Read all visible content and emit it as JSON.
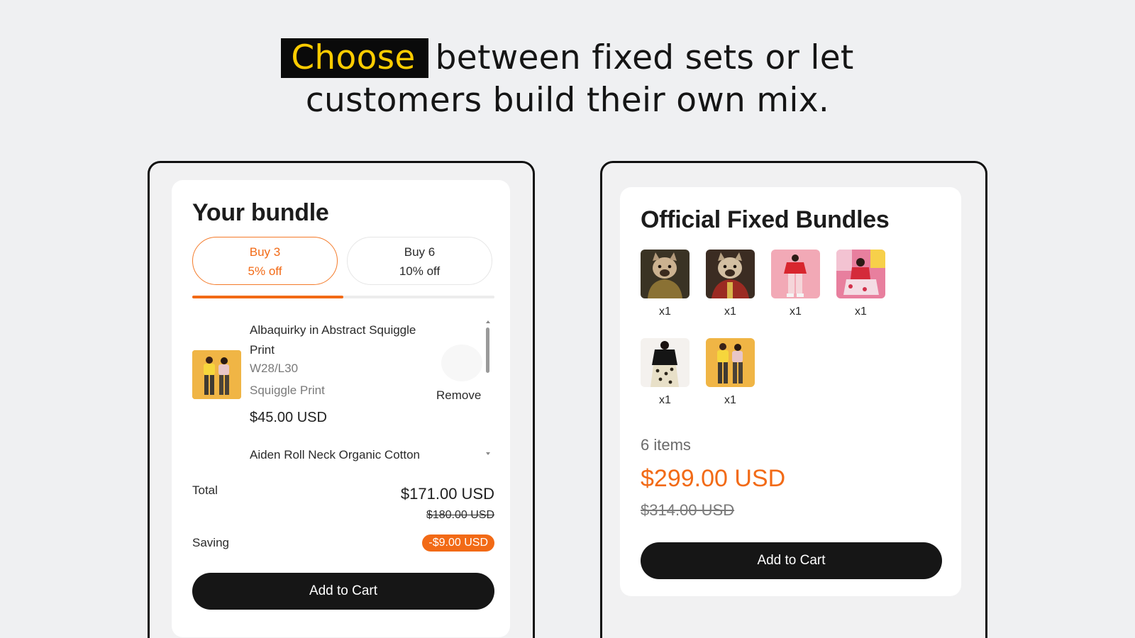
{
  "headline": {
    "highlight": "Choose",
    "line1_rest": "between fixed sets or let",
    "line2": "customers build their own mix."
  },
  "mix_bundle": {
    "title": "Your bundle",
    "tiers": [
      {
        "label": "Buy 3",
        "discount": "5% off",
        "selected": true
      },
      {
        "label": "Buy 6",
        "discount": "10% off",
        "selected": false
      }
    ],
    "progress_fraction": 0.5,
    "items": [
      {
        "name": "Albaquirky in Abstract Squiggle Print",
        "size": "W28/L30",
        "variant": "Squiggle Print",
        "price": "$45.00 USD",
        "remove_label": "Remove"
      },
      {
        "name": "Aiden Roll Neck Organic Cotton"
      }
    ],
    "total_label": "Total",
    "total_price": "$171.00 USD",
    "total_compare": "$180.00 USD",
    "saving_label": "Saving",
    "saving_value": "-$9.00 USD",
    "cta_label": "Add to Cart"
  },
  "fixed_bundle": {
    "title": "Official Fixed Bundles",
    "products": [
      {
        "qty": "x1",
        "image": "dog-portrait-gold-armor"
      },
      {
        "qty": "x1",
        "image": "dog-portrait-red-uniform"
      },
      {
        "qty": "x1",
        "image": "model-red-top-pink"
      },
      {
        "qty": "x1",
        "image": "model-pink-pattern-seated"
      },
      {
        "qty": "x1",
        "image": "model-black-top-leopard"
      },
      {
        "qty": "x1",
        "image": "models-yellow-backdrop"
      }
    ],
    "items_count": "6 items",
    "price": "$299.00 USD",
    "compare_price": "$314.00 USD",
    "cta_label": "Add to Cart"
  },
  "colors": {
    "accent": "#f26a16",
    "highlight_text": "#ffcc00",
    "button_bg": "#161616"
  }
}
